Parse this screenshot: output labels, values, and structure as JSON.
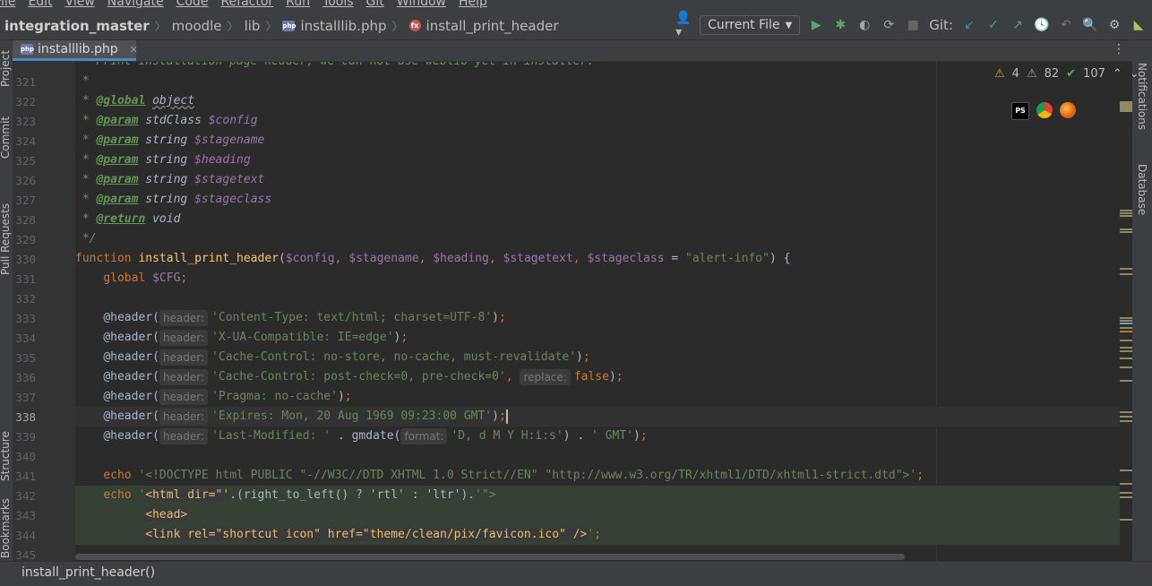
{
  "menu": [
    "File",
    "Edit",
    "View",
    "Navigate",
    "Code",
    "Refactor",
    "Run",
    "Tools",
    "Git",
    "Window",
    "Help"
  ],
  "breadcrumb": {
    "project": "integration_master",
    "folders": [
      "moodle",
      "lib"
    ],
    "file": "installlib.php",
    "function": "install_print_header"
  },
  "toolbar": {
    "run_config": "Current File",
    "git_label": "Git:"
  },
  "tab": {
    "label": "installlib.php",
    "icon": "php-file-icon"
  },
  "left_tool_windows": [
    "Project",
    "Commit",
    "Pull Requests",
    "Structure",
    "Bookmarks"
  ],
  "right_tool_windows": [
    "Notifications",
    "Database"
  ],
  "inspections": {
    "warnings": "4",
    "weak_warnings": "82",
    "ok": "107"
  },
  "browsers": [
    "phpstorm-icon",
    "chrome-icon",
    "firefox-icon"
  ],
  "line_numbers": [
    "321",
    "322",
    "323",
    "324",
    "325",
    "326",
    "327",
    "328",
    "329",
    "330",
    "331",
    "332",
    "333",
    "334",
    "335",
    "336",
    "337",
    "338",
    "339",
    "340",
    "341",
    "342",
    "343",
    "344",
    "345"
  ],
  "code": {
    "l321": " *",
    "l322_tag": "@global",
    "l322_rest": "object",
    "params": [
      {
        "type": "stdClass",
        "name": "$config"
      },
      {
        "type": "string",
        "name": "$stagename"
      },
      {
        "type": "string",
        "name": "$heading"
      },
      {
        "type": "string",
        "name": "$stagetext"
      },
      {
        "type": "string",
        "name": "$stageclass"
      }
    ],
    "param_tag": "@param",
    "return_tag": "@return",
    "return_type": "void",
    "l329": " */",
    "fn_kw": "function",
    "fn_name": "install_print_header",
    "fn_args": [
      "$config",
      "$stagename",
      "$heading",
      "$stagetext",
      "$stageclass"
    ],
    "fn_default": "\"alert-info\"",
    "global_kw": "global",
    "global_var": "$CFG",
    "header_call": "@header(",
    "hint_header": "header:",
    "hint_replace": "replace:",
    "hint_format": "format:",
    "headers": [
      "'Content-Type: text/html; charset=UTF-8'",
      "'X-UA-Compatible: IE=edge'",
      "'Cache-Control: no-store, no-cache, must-revalidate'",
      "'Cache-Control: post-check=0, pre-check=0'",
      "'Pragma: no-cache'",
      "'Expires: Mon, 20 Aug 1969 09:23:00 GMT'",
      "'Last-Modified: '"
    ],
    "false_kw": "false",
    "gmdate": "gmdate(",
    "gmdate_fmt": "'D, d M Y H:i:s'",
    "gmt": "' GMT'",
    "echo": "echo",
    "doctype": "'<!DOCTYPE html PUBLIC \"-//W3C//DTD XHTML 1.0 Strict//EN\" \"http://www.w3.org/TR/xhtml1/DTD/xhtml1-strict.dtd\">'",
    "html_open": "<html dir=\"'",
    "rtl": ".(right_to_left() ? 'rtl' : 'ltr').",
    "html_close": "'\">",
    "head": "<head>",
    "link": "<link rel=\"shortcut icon\" href=\"theme/clean/pix/favicon.ico\" />"
  },
  "status": {
    "breadcrumb": "install_print_header()"
  }
}
